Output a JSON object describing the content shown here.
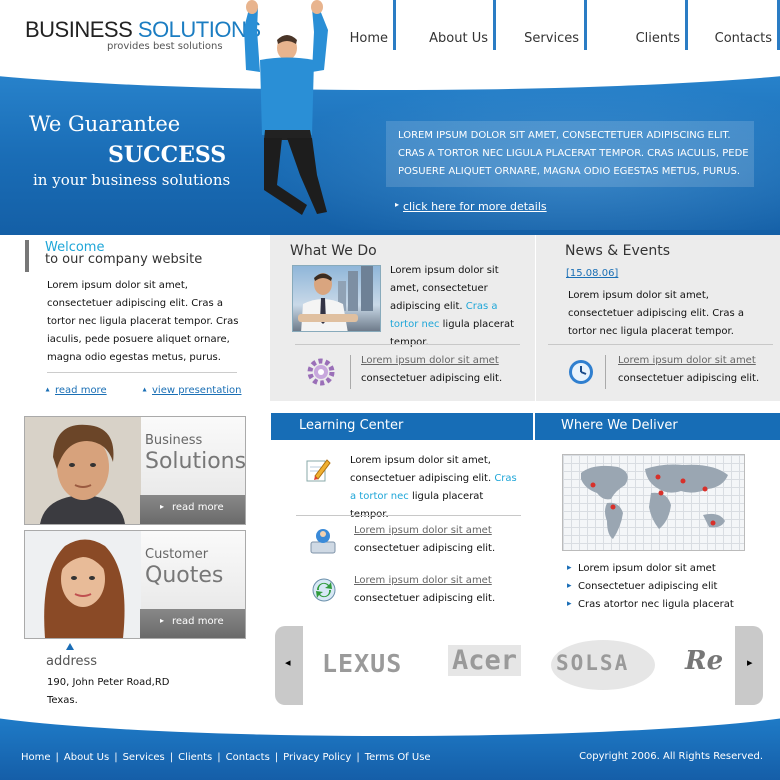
{
  "header": {
    "logo_part1": "BUSINESS",
    "logo_part2": "SOLUTIONS",
    "tagline": "provides best solutions",
    "nav": [
      "Home",
      "About Us",
      "Services",
      "Clients",
      "Contacts"
    ]
  },
  "banner": {
    "line1": "We Guarantee",
    "line2": "SUCCESS",
    "line3": "in your business solutions",
    "box_text": "LOREM IPSUM DOLOR SIT AMET, CONSECTETUER ADIPISCING ELIT. CRAS A TORTOR NEC LIGULA PLACERAT TEMPOR. CRAS IACULIS, PEDE POSUERE ALIQUET ORNARE, MAGNA ODIO EGESTAS METUS,  PURUS.",
    "link": "click here for more details"
  },
  "welcome": {
    "title1": "Welcome",
    "title2": "to our company website",
    "text": "Lorem ipsum dolor sit amet, consectetuer adipiscing elit. Cras a tortor nec ligula placerat tempor. Cras iaculis, pede posuere aliquet ornare, magna odio egestas metus,  purus.",
    "link_read_more": "read more",
    "link_view_presentation": "view presentation"
  },
  "what_we_do": {
    "title": "What We Do",
    "text_a": "Lorem ipsum dolor sit amet, consectetuer adipiscing elit. ",
    "text_highlight": "Cras a tortor nec",
    "text_b": " ligula placerat tempor.",
    "link": "Lorem ipsum dolor sit amet",
    "sub": "consectetuer adipiscing elit."
  },
  "news": {
    "title": "News & Events",
    "date": "[15.08.06]",
    "text": "Lorem ipsum dolor sit amet, consectetuer adipiscing elit. Cras a tortor nec ligula placerat tempor.",
    "link": "Lorem ipsum dolor sit amet",
    "sub": "consectetuer adipiscing elit."
  },
  "cards": [
    {
      "line1": "Business",
      "line2": "Solutions",
      "button": "read more"
    },
    {
      "line1": "Customer",
      "line2": "Quotes",
      "button": "read more"
    }
  ],
  "address": {
    "title": "address",
    "line1": "190, John Peter Road,RD",
    "line2": "Texas."
  },
  "learning": {
    "title": "Learning Center",
    "text_a": "Lorem ipsum dolor sit amet, consectetuer adipiscing elit. ",
    "text_highlight": "Cras a tortor nec",
    "text_b": " ligula placerat tempor.",
    "items": [
      {
        "link": "Lorem ipsum dolor sit amet",
        "sub": "consectetuer adipiscing elit."
      },
      {
        "link": "Lorem ipsum dolor sit amet",
        "sub": "consectetuer adipiscing elit."
      }
    ]
  },
  "where": {
    "title": "Where We Deliver",
    "bullets": [
      "Lorem ipsum dolor sit amet",
      "Consectetuer adipiscing elit",
      "Cras atortor nec ligula placerat"
    ]
  },
  "partners": [
    "LEXUS",
    "Acer",
    "SOLSA",
    "Re"
  ],
  "footer": {
    "links": [
      "Home",
      "About Us",
      "Services",
      "Clients",
      "Contacts",
      "Privacy Policy",
      "Terms Of Use"
    ],
    "copyright": "Copyright 2006. All Rights Reserved."
  },
  "colors": {
    "brand_blue": "#176db6",
    "accent_cyan": "#1fa6d8",
    "panel_grey": "#ececec"
  }
}
